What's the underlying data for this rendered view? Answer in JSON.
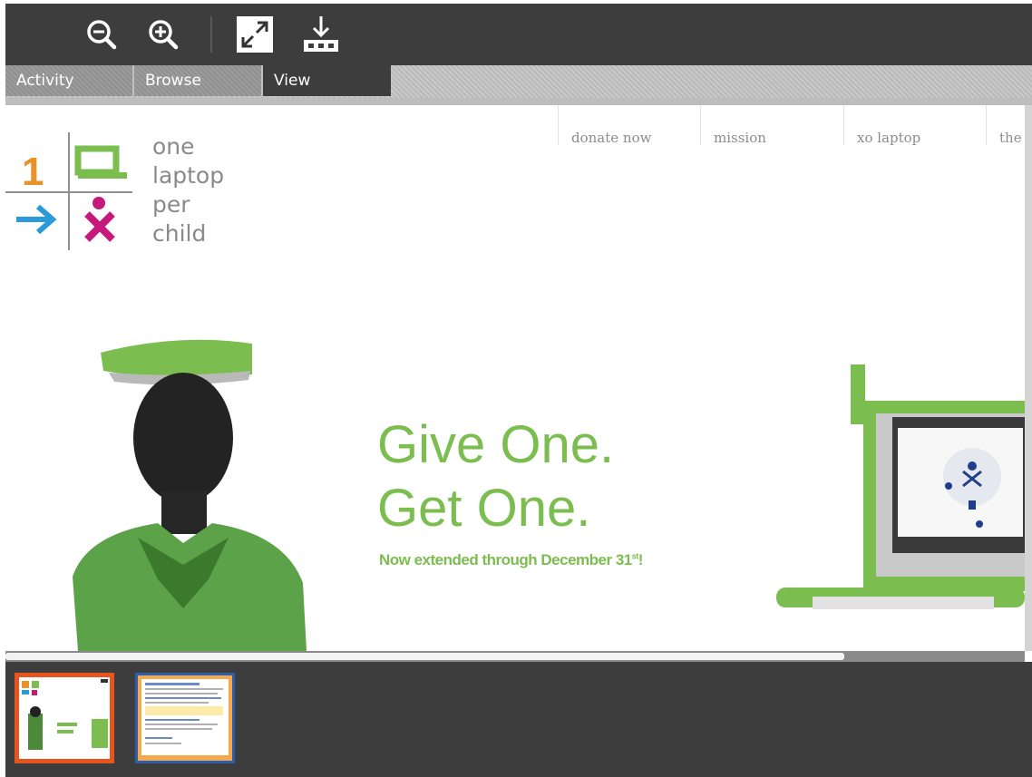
{
  "toolbar": {
    "zoom_out_icon": "zoom-out-icon",
    "zoom_in_icon": "zoom-in-icon",
    "fullscreen_icon": "fullscreen-icon",
    "download_icon": "download-icon"
  },
  "tabs": [
    {
      "label": "Activity",
      "active": false
    },
    {
      "label": "Browse",
      "active": false
    },
    {
      "label": "View",
      "active": true
    }
  ],
  "page": {
    "nav": [
      "donate now",
      "mission",
      "xo laptop",
      "the"
    ],
    "logo": {
      "digit": "1",
      "lines": [
        "one",
        "laptop",
        "per",
        "child"
      ]
    },
    "headline_1": "Give One.",
    "headline_2": "Get One.",
    "subline": "Now extended through December 31",
    "subline_sup": "st",
    "accent_color": "#7cbd4f"
  },
  "thumbnails": [
    {
      "name": "page-1",
      "selected": true,
      "border": "#e8541d"
    },
    {
      "name": "page-2",
      "selected": false,
      "border": "#2b5fae"
    }
  ]
}
